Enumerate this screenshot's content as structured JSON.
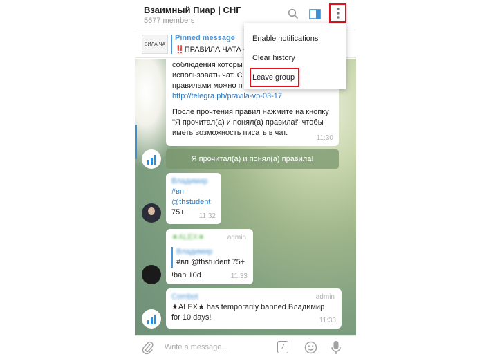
{
  "header": {
    "title": "Взаимный Пиар | СНГ",
    "members": "5677 members",
    "icons": [
      "search-icon",
      "sidebar-panel-icon",
      "more-vertical-icon"
    ]
  },
  "pinned": {
    "title": "Pinned message",
    "text": "‼️ПРАВИЛА ЧАТА «В",
    "thumb_text": "ВИЛА ЧА"
  },
  "messages": {
    "rules": {
      "lines": [
        "соблюдения которы",
        "использовать чат. С",
        "правилами можно п"
      ],
      "link": "http://telegra.ph/pravila-vp-03-17",
      "after": [
        "После прочтения правил нажмите на кнопку",
        "\"Я прочитал(а) и понял(а) правила!\" чтобы",
        "иметь возможность писать в чат."
      ],
      "time": "11:30"
    },
    "button": "Я прочитал(а) и понял(а) правила!",
    "m2": {
      "sender": "Владимир",
      "lines": [
        "#вп",
        "@thstudent",
        "75+"
      ],
      "time": "11:32"
    },
    "m3": {
      "sender": "★ALEX★",
      "admin": "admin",
      "quote_sender": "Владимир",
      "quote": "#вп @thstudent 75+",
      "text": "!ban 10d",
      "time": "11:33"
    },
    "m4": {
      "sender": "Combot",
      "admin": "admin",
      "line1": "★ALEX★ has temporarily banned Владимир",
      "line2": "for 10 days!",
      "time": "11:33"
    }
  },
  "input": {
    "placeholder": "Write a message..."
  },
  "menu": {
    "items": [
      "Enable notifications",
      "Clear history",
      "Leave group"
    ]
  },
  "colors": {
    "accent": "#4a95d6",
    "highlight": "#e3131b"
  }
}
